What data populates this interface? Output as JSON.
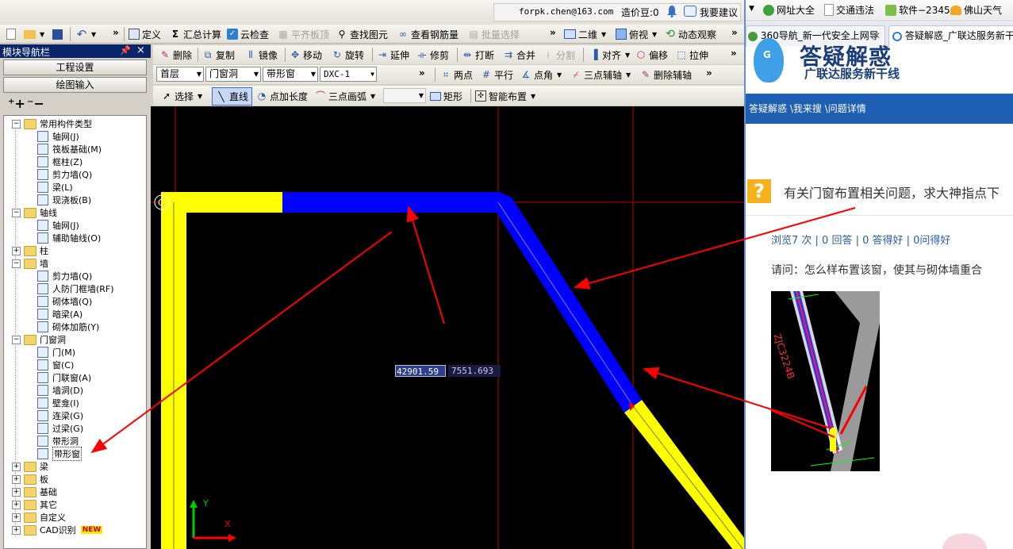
{
  "app": {
    "user_email": "forpk.chen@163.com",
    "cost_beans_label": "造价豆:0",
    "suggest_label": "我要建议",
    "toolbar1": {
      "define": "定义",
      "summary_calc": "汇总计算",
      "cloud_check": "云检查",
      "flat_slab_top": "平齐板顶",
      "find_element": "查找图元",
      "view_rebar": "查看钢筋量",
      "batch_select": "批量选择",
      "view_2d": "二维",
      "top_view": "俯视",
      "dynamic_view": "动态观察"
    },
    "toolbar2": {
      "delete": "删除",
      "copy": "复制",
      "mirror": "镜像",
      "move": "移动",
      "rotate": "旋转",
      "extend": "延伸",
      "trim": "修剪",
      "break": "打断",
      "merge": "合并",
      "split": "分割",
      "align": "对齐",
      "offset": "偏移",
      "stretch": "拉伸"
    },
    "toolbar3": {
      "floor": "首层",
      "category": "门窗洞",
      "component": "带形窗",
      "name": "DXC-1",
      "two_points": "两点",
      "parallel": "平行",
      "point_angle": "点角",
      "three_point_aux": "三点辅轴",
      "delete_aux": "删除辅轴"
    },
    "toolbar4": {
      "select": "选择",
      "line": "直线",
      "point_length": "点加长度",
      "three_point_arc": "三点画弧",
      "rectangle": "矩形",
      "smart_layout": "智能布置"
    },
    "nav": {
      "title": "模块导航栏",
      "pin": "ʮ",
      "close": "×",
      "btn_project": "工程设置",
      "btn_draw": "绘图输入",
      "tree": [
        {
          "label": "常用构件类型",
          "type": "folder",
          "exp": "−",
          "level": 0
        },
        {
          "label": "轴网(J)",
          "type": "leaf",
          "level": 1
        },
        {
          "label": "筏板基础(M)",
          "type": "leaf",
          "level": 1
        },
        {
          "label": "框柱(Z)",
          "type": "leaf",
          "level": 1
        },
        {
          "label": "剪力墙(Q)",
          "type": "leaf",
          "level": 1
        },
        {
          "label": "梁(L)",
          "type": "leaf",
          "level": 1
        },
        {
          "label": "现浇板(B)",
          "type": "leaf",
          "level": 1
        },
        {
          "label": "轴线",
          "type": "folder",
          "exp": "−",
          "level": 0
        },
        {
          "label": "轴网(J)",
          "type": "leaf",
          "level": 1
        },
        {
          "label": "辅助轴线(O)",
          "type": "leaf",
          "level": 1
        },
        {
          "label": "柱",
          "type": "folder",
          "exp": "+",
          "level": 0
        },
        {
          "label": "墙",
          "type": "folder",
          "exp": "−",
          "level": 0
        },
        {
          "label": "剪力墙(Q)",
          "type": "leaf",
          "level": 1
        },
        {
          "label": "人防门框墙(RF)",
          "type": "leaf",
          "level": 1
        },
        {
          "label": "砌体墙(Q)",
          "type": "leaf",
          "level": 1
        },
        {
          "label": "暗梁(A)",
          "type": "leaf",
          "level": 1
        },
        {
          "label": "砌体加筋(Y)",
          "type": "leaf",
          "level": 1
        },
        {
          "label": "门窗洞",
          "type": "folder",
          "exp": "−",
          "level": 0
        },
        {
          "label": "门(M)",
          "type": "leaf",
          "level": 1
        },
        {
          "label": "窗(C)",
          "type": "leaf",
          "level": 1
        },
        {
          "label": "门联窗(A)",
          "type": "leaf",
          "level": 1
        },
        {
          "label": "墙洞(D)",
          "type": "leaf",
          "level": 1
        },
        {
          "label": "壁龛(I)",
          "type": "leaf",
          "level": 1
        },
        {
          "label": "连梁(G)",
          "type": "leaf",
          "level": 1
        },
        {
          "label": "过梁(G)",
          "type": "leaf",
          "level": 1
        },
        {
          "label": "带形洞",
          "type": "leaf",
          "level": 1
        },
        {
          "label": "带形窗",
          "type": "leaf",
          "level": 1,
          "selected": true
        },
        {
          "label": "梁",
          "type": "folder",
          "exp": "+",
          "level": 0
        },
        {
          "label": "板",
          "type": "folder",
          "exp": "+",
          "level": 0
        },
        {
          "label": "基础",
          "type": "folder",
          "exp": "+",
          "level": 0
        },
        {
          "label": "其它",
          "type": "folder",
          "exp": "+",
          "level": 0
        },
        {
          "label": "自定义",
          "type": "folder",
          "exp": "+",
          "level": 0
        },
        {
          "label": "CAD识别",
          "type": "folder",
          "exp": "+",
          "level": 0,
          "badge": "NEW"
        }
      ]
    },
    "canvas": {
      "coord_x": "42901.59",
      "coord_y": "7551.693",
      "axis_y": "Y",
      "axis_x": "X"
    }
  },
  "browser": {
    "favorites": {
      "site_nav": "网址大全",
      "traffic": "交通违法",
      "software": "软件−2345",
      "weather": "佛山天气"
    },
    "tabs": [
      "360导航_新一代安全上网导",
      "答疑解惑_广联达服务新干"
    ],
    "site": {
      "logo_text": "答疑解惑",
      "logo_sub": "广联达服务新干线",
      "breadcrumb": "答疑解惑 \\我来搜 \\问题详情",
      "question_title": "有关门窗布置相关问题，求大神指点下",
      "stats": "浏览7 次 | 0 回答 | 0 答得好 | 0问得好",
      "question_body": "请问：怎么样布置该窗，使其与砌体墙重合",
      "image_label": "ZJC3224B"
    }
  },
  "colors": {
    "wall_yellow": "#ffff00",
    "window_blue": "#0000ff",
    "axis_red": "#c00000",
    "arrow_red": "#ff0000",
    "link_blue": "#2a5caa",
    "banner_blue": "#1e5fb4"
  }
}
